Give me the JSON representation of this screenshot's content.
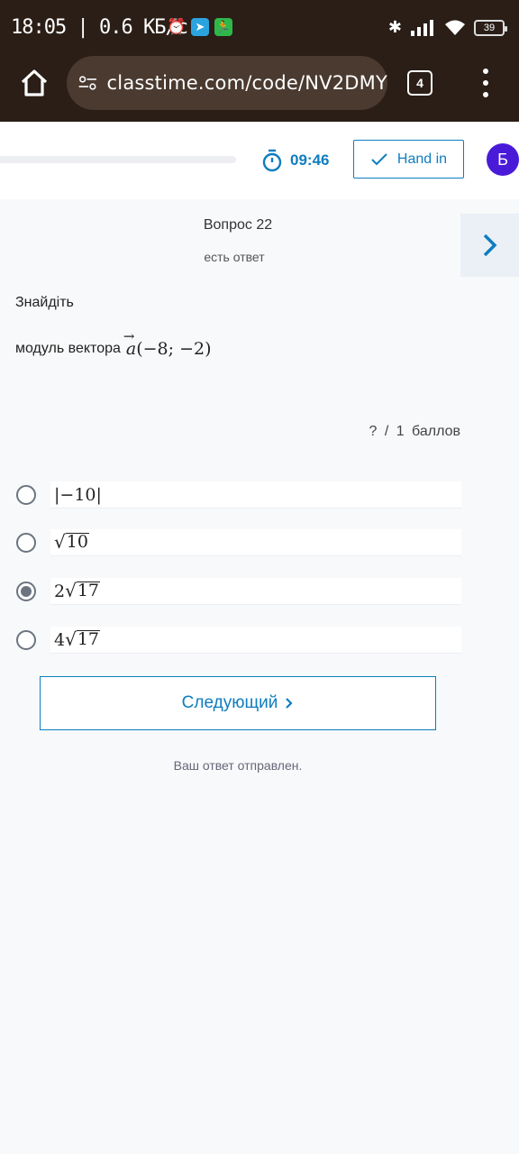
{
  "status_bar": {
    "time": "18:05",
    "speed": "| 0.6 КБ/с",
    "battery": "39",
    "icons": [
      "alarm-icon",
      "telegram-icon",
      "fitness-icon",
      "bluetooth-icon",
      "signal-icon",
      "wifi-icon",
      "battery-icon"
    ]
  },
  "browser": {
    "url": "classtime.com/code/NV2DMY",
    "tab_count": "4"
  },
  "header": {
    "timer": "09:46",
    "hand_in_label": "Hand in",
    "avatar_letter": "Б",
    "accent_color": "#0e7dbf",
    "avatar_color": "#4a1ad9"
  },
  "question": {
    "title": "Вопрос 22",
    "status": "есть ответ",
    "line1": "Знайдіть",
    "line2": "модуль вектора",
    "vector_name": "a",
    "vector_coords": "(−8; −2)",
    "points": "? / 1 баллов",
    "options": [
      {
        "text": "|−10|",
        "selected": false
      },
      {
        "coef": "",
        "radicand": "10",
        "selected": false
      },
      {
        "coef": "2",
        "radicand": "17",
        "selected": true
      },
      {
        "coef": "4",
        "radicand": "17",
        "selected": false
      }
    ]
  },
  "footer": {
    "next_label": "Следующий",
    "sent_message": "Ваш ответ отправлен."
  }
}
